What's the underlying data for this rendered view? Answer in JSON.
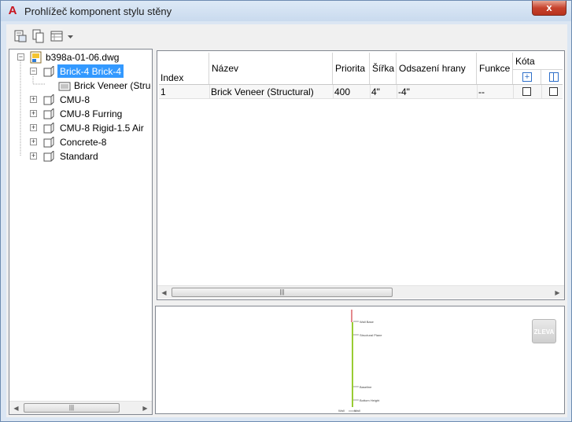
{
  "window": {
    "title": "Prohlížeč komponent stylu stěny",
    "close_label": "x"
  },
  "tree": {
    "file": "b398a-01-06.dwg",
    "items": [
      {
        "label": "Brick-4 Brick-4",
        "selected": true,
        "expanded": true
      },
      {
        "label": "Brick Veneer (Structural)",
        "child": true
      },
      {
        "label": "CMU-8"
      },
      {
        "label": "CMU-8 Furring"
      },
      {
        "label": "CMU-8 Rigid-1.5 Air"
      },
      {
        "label": "Concrete-8"
      },
      {
        "label": "Standard"
      }
    ]
  },
  "grid": {
    "headers": {
      "index": "Index",
      "name": "Název",
      "priority": "Priorita",
      "width": "Šířka",
      "edge_offset": "Odsazení hrany",
      "function": "Funkce",
      "dimension": "Kóta"
    },
    "rows": [
      {
        "index": "1",
        "name": "Brick Veneer (Structural)",
        "priority": "400",
        "width": "4\"",
        "edge_offset": "-4\"",
        "function": "--"
      }
    ]
  },
  "preview": {
    "view_button": "ZLEVA",
    "labels": [
      "Wall Base",
      "Structural Plane",
      "Baseline",
      "Bottom Height",
      "Wall",
      "Wall"
    ]
  },
  "colors": {
    "selection": "#3399ff",
    "preview_line": "#99cc33",
    "accent_red": "#c8141e"
  }
}
